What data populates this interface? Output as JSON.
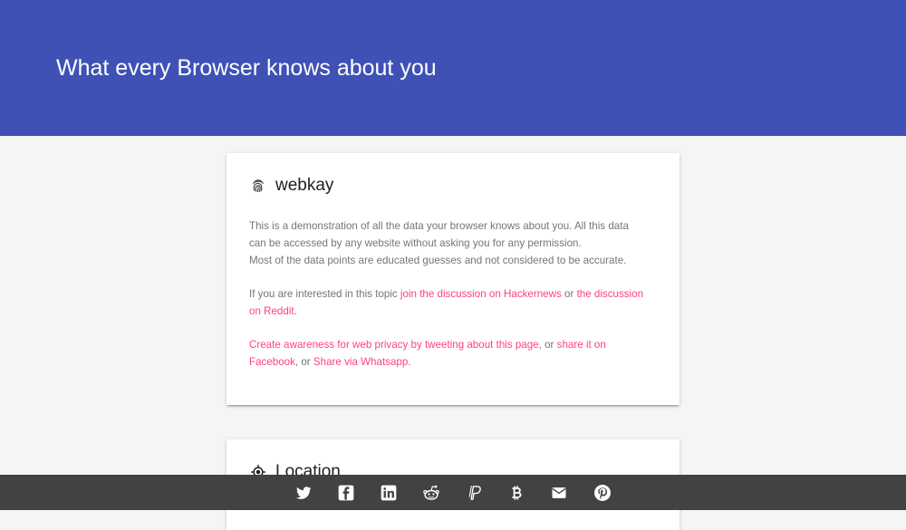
{
  "header": {
    "title": "What every Browser knows about you"
  },
  "intro_card": {
    "title": "webkay",
    "icon": "fingerprint-icon",
    "description_line1": "This is a demonstration of all the data your browser knows about you. All this data can be accessed by any website without asking you for any permission.",
    "description_line2": "Most of the data points are educated guesses and not considered to be accurate.",
    "discussion_prefix": "If you are interested in this topic ",
    "hackernews_link": "join the discussion on Hackernews",
    "discussion_or": " or ",
    "reddit_link": "the discussion on Reddit",
    "discussion_suffix": ".",
    "tweet_link": "Create awareness for web privacy by tweeting about this page",
    "share_sep1": ", or ",
    "facebook_link": "share it on Facebook",
    "share_sep2": ", or ",
    "whatsapp_link": "Share via Whatsapp",
    "share_suffix": "."
  },
  "location_card": {
    "title": "Location",
    "icon": "crosshair-icon"
  },
  "footer": {
    "background": "#424242",
    "icons": [
      "twitter-icon",
      "facebook-icon",
      "linkedin-icon",
      "reddit-icon",
      "paypal-icon",
      "bitcoin-icon",
      "email-icon",
      "pinterest-icon"
    ]
  },
  "colors": {
    "primary": "#3f51b5",
    "accent": "#ff4081",
    "background": "#f5f5f5",
    "body_text": "#757575"
  }
}
